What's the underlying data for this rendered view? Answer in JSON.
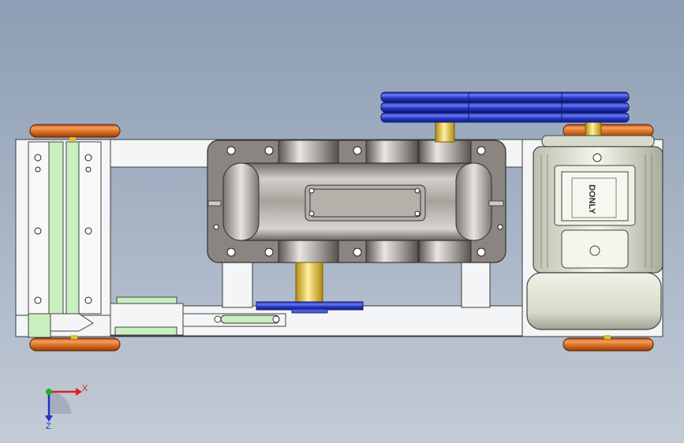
{
  "viewport": {
    "background_top": "#8d9db3",
    "background_bottom": "#c3cbd6"
  },
  "model": {
    "motor_nameplate_text": "DONLY",
    "colors": {
      "frame": "#f4f5f6",
      "frame_edge": "#3a3a3a",
      "gearbox_plate": "#8a8580",
      "gearbox_body": "#a6a29c",
      "roller": "#e07a2c",
      "pulley": "#2838c8",
      "shaft": "#e8c020",
      "motor_body": "#e3e5d5",
      "rail": "#c8efc0"
    }
  },
  "triad": {
    "x_label": "X",
    "y_label": "Y",
    "z_label": "Z",
    "x_color": "#e02020",
    "y_color": "#20b020",
    "z_color": "#2030c8"
  }
}
